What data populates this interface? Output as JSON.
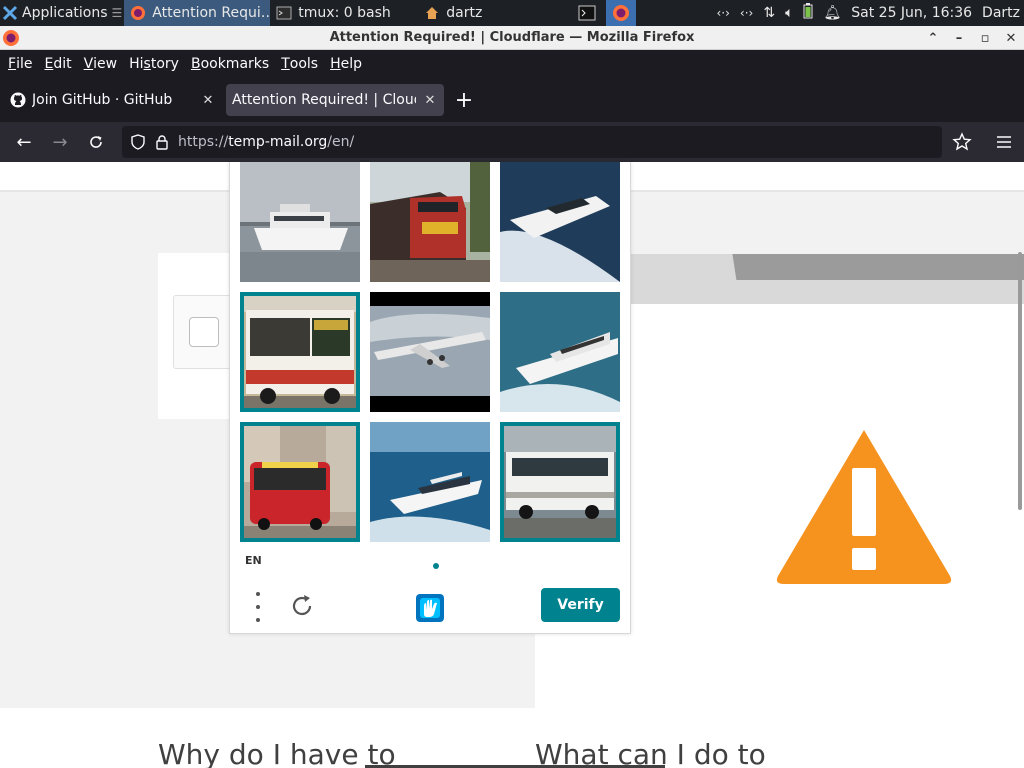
{
  "panel": {
    "applications": "Applications",
    "tasks": [
      {
        "label": "Attention Requi…",
        "active": true
      },
      {
        "label": "tmux: 0 bash",
        "active": false
      },
      {
        "label": "dartz",
        "active": false
      }
    ],
    "clock": "Sat 25 Jun, 16:36",
    "user": "Dartz"
  },
  "window": {
    "title": "Attention Required! | Cloudflare — Mozilla Firefox"
  },
  "menubar": {
    "items": [
      {
        "label": "File",
        "accel": "F",
        "rest": "ile"
      },
      {
        "label": "Edit",
        "accel": "E",
        "rest": "dit"
      },
      {
        "label": "View",
        "accel": "V",
        "rest": "iew"
      },
      {
        "label": "History",
        "pre": "Hi",
        "accel": "s",
        "rest": "tory"
      },
      {
        "label": "Bookmarks",
        "accel": "B",
        "rest": "ookmarks"
      },
      {
        "label": "Tools",
        "accel": "T",
        "rest": "ools"
      },
      {
        "label": "Help",
        "accel": "H",
        "rest": "elp"
      }
    ]
  },
  "tabs": [
    {
      "title": "Join GitHub · GitHub",
      "selected": false
    },
    {
      "title": "Attention Required! | Cloudfl",
      "selected": true
    }
  ],
  "urlbar": {
    "scheme": "https://",
    "host": "temp-mail.org",
    "path": "/en/"
  },
  "page": {
    "heading_left": "Why do I have to",
    "heading_right": "What can I do to",
    "warning_color": "#f6921e"
  },
  "captcha": {
    "language": "EN",
    "verify_label": "Verify",
    "accent": "#00838f",
    "tiles": [
      {
        "subject": "boat",
        "selected": false
      },
      {
        "subject": "train",
        "selected": false
      },
      {
        "subject": "speedboat",
        "selected": false
      },
      {
        "subject": "bus",
        "selected": true
      },
      {
        "subject": "airplane",
        "selected": false
      },
      {
        "subject": "yacht",
        "selected": false
      },
      {
        "subject": "red-bus",
        "selected": true
      },
      {
        "subject": "yacht",
        "selected": false
      },
      {
        "subject": "white-bus",
        "selected": true
      }
    ]
  }
}
